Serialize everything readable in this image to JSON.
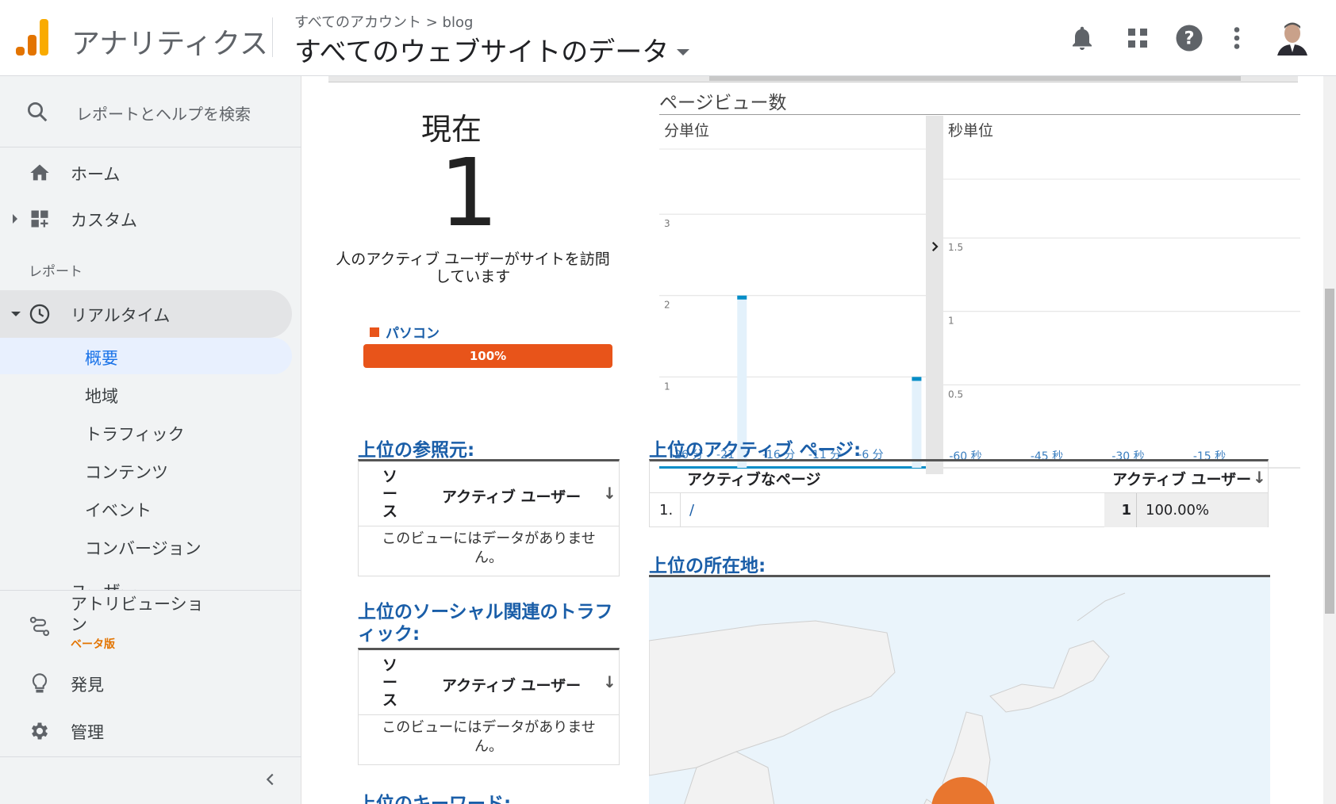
{
  "header": {
    "app_name": "アナリティクス",
    "breadcrumb": "すべてのアカウント > blog",
    "view_title": "すべてのウェブサイトのデータ"
  },
  "sidebar": {
    "search_placeholder": "レポートとヘルプを検索",
    "home": "ホーム",
    "custom": "カスタム",
    "section_reports": "レポート",
    "realtime": "リアルタイム",
    "realtime_sub": [
      "概要",
      "地域",
      "トラフィック",
      "コンテンツ",
      "イベント",
      "コンバージョン"
    ],
    "users_partial": "ユーザー",
    "attribution_line1": "アトリビューショ",
    "attribution_line2": "ン",
    "beta": "ベータ版",
    "discover": "発見",
    "admin": "管理"
  },
  "realtime": {
    "now_label": "現在",
    "active_count": "1",
    "active_desc": "人のアクティブ ユーザーがサイトを訪問しています",
    "device_label": "パソコン",
    "device_pct": "100%",
    "device_value": 1.0
  },
  "pageviews": {
    "title": "ページビュー数",
    "per_minute_label": "分単位",
    "per_second_label": "秒単位"
  },
  "referrers": {
    "title": "上位の参照元:",
    "col_source": "ソース",
    "col_users": "アクティブ ユーザー",
    "empty": "このビューにはデータがありません。"
  },
  "social": {
    "title": "上位のソーシャル関連のトラフィック:",
    "col_source": "ソース",
    "col_users": "アクティブ ユーザー",
    "empty": "このビューにはデータがありません。"
  },
  "keywords": {
    "title": "上位のキーワード:"
  },
  "active_pages": {
    "title": "上位のアクティブ ページ:",
    "col_page": "アクティブなページ",
    "col_users": "アクティブ ユーザー",
    "rows": [
      {
        "rank": "1.",
        "page": "/",
        "users": "1",
        "pct": "100.00%"
      }
    ]
  },
  "locations": {
    "title": "上位の所在地:"
  },
  "chart_data": [
    {
      "type": "bar",
      "title": "分単位",
      "x_ticks": [
        "-26 分",
        "-21 分",
        "-16 分",
        "-11 分",
        "-6 分"
      ],
      "x_range": [
        -29,
        0
      ],
      "y_ticks": [
        "1",
        "2",
        "3"
      ],
      "ylim": [
        0,
        3.8
      ],
      "bars": [
        {
          "x": -20,
          "value": 2
        },
        {
          "x": -1,
          "value": 1
        }
      ]
    },
    {
      "type": "bar",
      "title": "秒単位",
      "x_ticks": [
        "-60 秒",
        "-45 秒",
        "-30 秒",
        "-15 秒"
      ],
      "y_ticks": [
        "0.5",
        "1",
        "1.5"
      ],
      "ylim": [
        0,
        1.9
      ],
      "bars": []
    }
  ],
  "colors": {
    "accent": "#e8541a",
    "link": "#1a5ea8",
    "bar": "#058dc7",
    "bar_bg": "#e3f1fb"
  }
}
